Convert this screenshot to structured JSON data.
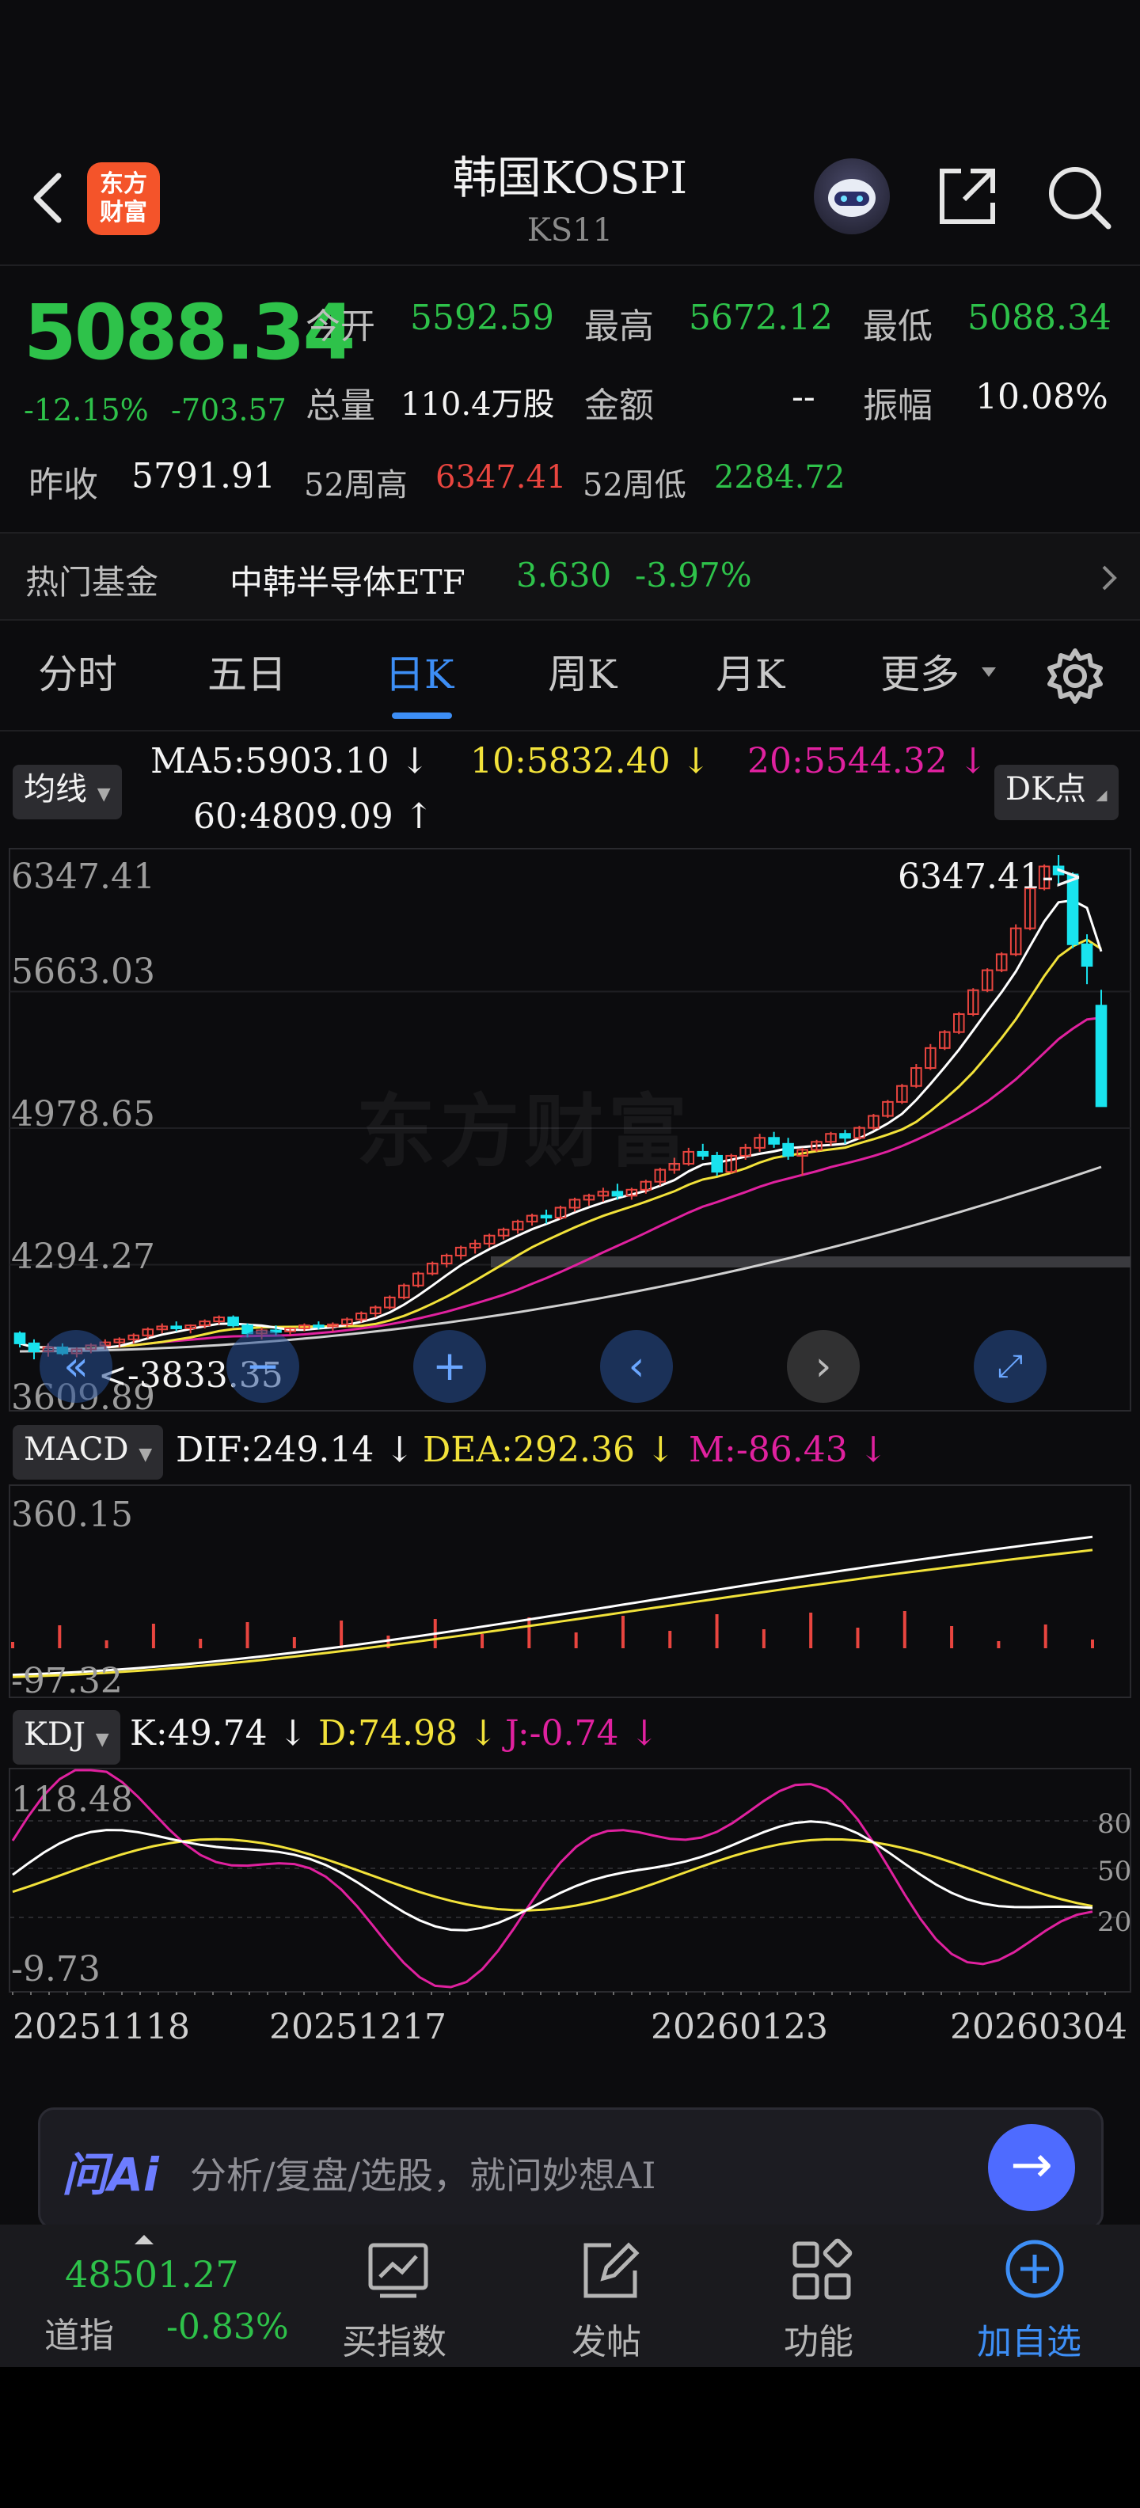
{
  "header": {
    "title": "韩国KOSPI",
    "code": "KS11",
    "logo_text": "东方财富"
  },
  "quote": {
    "price": "5088.34",
    "change_pct": "-12.15%",
    "change": "-703.57",
    "open_label": "今开",
    "open": "5592.59",
    "high_label": "最高",
    "high": "5672.12",
    "low_label": "最低",
    "low": "5088.34",
    "volume_label": "总量",
    "volume": "110.4万股",
    "amount_label": "金额",
    "amount": "--",
    "amplitude_label": "振幅",
    "amplitude": "10.08%",
    "prev_close_label": "昨收",
    "prev_close": "5791.91",
    "w52_high_label": "52周高",
    "w52_high": "6347.41",
    "w52_low_label": "52周低",
    "w52_low": "2284.72"
  },
  "fund": {
    "label": "热门基金",
    "name": "中韩半导体ETF",
    "price": "3.630",
    "change": "-3.97%"
  },
  "tabs": [
    "分时",
    "五日",
    "日K",
    "周K",
    "月K",
    "更多"
  ],
  "active_tab": "日K",
  "ma_bar": {
    "selector": "均线",
    "ma5": "MA5:5903.10",
    "ma10": "10:5832.40",
    "ma20": "20:5544.32",
    "ma60": "60:4809.09",
    "dk": "DK点"
  },
  "price_axis": [
    "6347.41",
    "5663.03",
    "4978.65",
    "4294.27",
    "3609.89"
  ],
  "annotations": {
    "high_marker": "6347.41->",
    "low_marker": "<-3833.35"
  },
  "watermark": "东方财富",
  "macd": {
    "selector": "MACD",
    "dif": "DIF:249.14",
    "dea": "DEA:292.36",
    "m": "M:-86.43",
    "axis_top": "360.15",
    "axis_bottom": "-97.32"
  },
  "kdj": {
    "selector": "KDJ",
    "k": "K:49.74",
    "d": "D:74.98",
    "j": "J:-0.74",
    "axis_top": "118.48",
    "axis_bottom": "-9.73",
    "right_ticks": [
      "80",
      "50",
      "20"
    ]
  },
  "dates": [
    "20251118",
    "20251217",
    "20260123",
    "20260304"
  ],
  "ai_bar": {
    "logo": "问Ai",
    "placeholder": "分析/复盘/选股，就问妙想AI"
  },
  "bottom_nav": {
    "index_value": "48501.27",
    "index_name": "道指",
    "index_change": "-0.83%",
    "items": [
      "买指数",
      "发帖",
      "功能",
      "加自选"
    ]
  },
  "colors": {
    "up": "#e9453f",
    "down": "#19e3ee",
    "green": "#2ec24a",
    "ma5": "#ffffff",
    "ma10": "#f2e23a",
    "ma20": "#e0219f",
    "ma60": "#d0d0d0",
    "accent": "#3d8ef5"
  },
  "chart_data": [
    {
      "type": "candlestick",
      "title": "日K",
      "ylim": [
        3609.89,
        6347.41
      ],
      "x_ticks": [
        "20251118",
        "20251217",
        "20260123",
        "20260304"
      ],
      "ohlc": [
        [
          3950,
          3960,
          3880,
          3900
        ],
        [
          3900,
          3920,
          3820,
          3860
        ],
        [
          3860,
          3900,
          3833.35,
          3880
        ],
        [
          3880,
          3900,
          3840,
          3850
        ],
        [
          3850,
          3880,
          3830,
          3870
        ],
        [
          3870,
          3900,
          3850,
          3890
        ],
        [
          3890,
          3920,
          3870,
          3905
        ],
        [
          3905,
          3930,
          3880,
          3920
        ],
        [
          3920,
          3950,
          3900,
          3940
        ],
        [
          3940,
          3980,
          3925,
          3970
        ],
        [
          3970,
          4000,
          3950,
          3985
        ],
        [
          3985,
          4010,
          3960,
          3975
        ],
        [
          3975,
          3995,
          3950,
          3990
        ],
        [
          3990,
          4020,
          3975,
          4010
        ],
        [
          4010,
          4040,
          3995,
          4030
        ],
        [
          4030,
          4040,
          3980,
          3990
        ],
        [
          3990,
          4000,
          3930,
          3950
        ],
        [
          3950,
          3980,
          3920,
          3965
        ],
        [
          3965,
          3990,
          3940,
          3960
        ],
        [
          3960,
          3980,
          3940,
          3975
        ],
        [
          3975,
          4000,
          3960,
          3990
        ],
        [
          3990,
          4010,
          3970,
          3985
        ],
        [
          3985,
          4005,
          3960,
          3995
        ],
        [
          3995,
          4030,
          3980,
          4020
        ],
        [
          4020,
          4060,
          4005,
          4050
        ],
        [
          4050,
          4090,
          4030,
          4080
        ],
        [
          4080,
          4140,
          4070,
          4130
        ],
        [
          4130,
          4200,
          4120,
          4190
        ],
        [
          4190,
          4260,
          4180,
          4250
        ],
        [
          4250,
          4310,
          4240,
          4300
        ],
        [
          4300,
          4350,
          4280,
          4340
        ],
        [
          4340,
          4390,
          4320,
          4380
        ],
        [
          4380,
          4420,
          4350,
          4400
        ],
        [
          4400,
          4450,
          4380,
          4440
        ],
        [
          4440,
          4480,
          4420,
          4470
        ],
        [
          4470,
          4520,
          4450,
          4510
        ],
        [
          4510,
          4550,
          4490,
          4540
        ],
        [
          4540,
          4570,
          4500,
          4530
        ],
        [
          4530,
          4590,
          4520,
          4580
        ],
        [
          4580,
          4630,
          4560,
          4620
        ],
        [
          4620,
          4650,
          4590,
          4640
        ],
        [
          4640,
          4680,
          4610,
          4660
        ],
        [
          4660,
          4700,
          4620,
          4640
        ],
        [
          4640,
          4680,
          4620,
          4670
        ],
        [
          4670,
          4720,
          4650,
          4710
        ],
        [
          4710,
          4780,
          4690,
          4770
        ],
        [
          4770,
          4830,
          4750,
          4800
        ],
        [
          4800,
          4880,
          4790,
          4860
        ],
        [
          4860,
          4900,
          4820,
          4840
        ],
        [
          4840,
          4860,
          4740,
          4760
        ],
        [
          4760,
          4850,
          4750,
          4840
        ],
        [
          4840,
          4900,
          4820,
          4880
        ],
        [
          4880,
          4950,
          4860,
          4930
        ],
        [
          4930,
          4960,
          4880,
          4900
        ],
        [
          4900,
          4930,
          4820,
          4840
        ],
        [
          4840,
          4880,
          4740,
          4870
        ],
        [
          4870,
          4920,
          4860,
          4910
        ],
        [
          4910,
          4960,
          4890,
          4950
        ],
        [
          4950,
          4970,
          4900,
          4930
        ],
        [
          4930,
          4990,
          4920,
          4980
        ],
        [
          4980,
          5050,
          4970,
          5040
        ],
        [
          5040,
          5120,
          5030,
          5110
        ],
        [
          5110,
          5200,
          5100,
          5190
        ],
        [
          5190,
          5300,
          5180,
          5280
        ],
        [
          5280,
          5400,
          5270,
          5380
        ],
        [
          5380,
          5470,
          5370,
          5460
        ],
        [
          5460,
          5560,
          5450,
          5550
        ],
        [
          5550,
          5680,
          5540,
          5670
        ],
        [
          5670,
          5780,
          5660,
          5770
        ],
        [
          5770,
          5860,
          5760,
          5850
        ],
        [
          5850,
          6000,
          5840,
          5980
        ],
        [
          5980,
          6200,
          5970,
          6180
        ],
        [
          6180,
          6300,
          6170,
          6290
        ],
        [
          6290,
          6347.41,
          6200,
          6250
        ],
        [
          6250,
          6260,
          5880,
          5900
        ],
        [
          5900,
          5950,
          5700,
          5791.91
        ],
        [
          5592.59,
          5672.12,
          5088.34,
          5088.34
        ]
      ]
    },
    {
      "type": "line",
      "title": "MACD",
      "series": [
        {
          "name": "DIF"
        },
        {
          "name": "DEA"
        },
        {
          "name": "M"
        }
      ],
      "ylim": [
        -97.32,
        360.15
      ]
    },
    {
      "type": "line",
      "title": "KDJ",
      "series": [
        {
          "name": "K"
        },
        {
          "name": "D"
        },
        {
          "name": "J"
        }
      ],
      "ylim": [
        -9.73,
        118.48
      ]
    }
  ]
}
